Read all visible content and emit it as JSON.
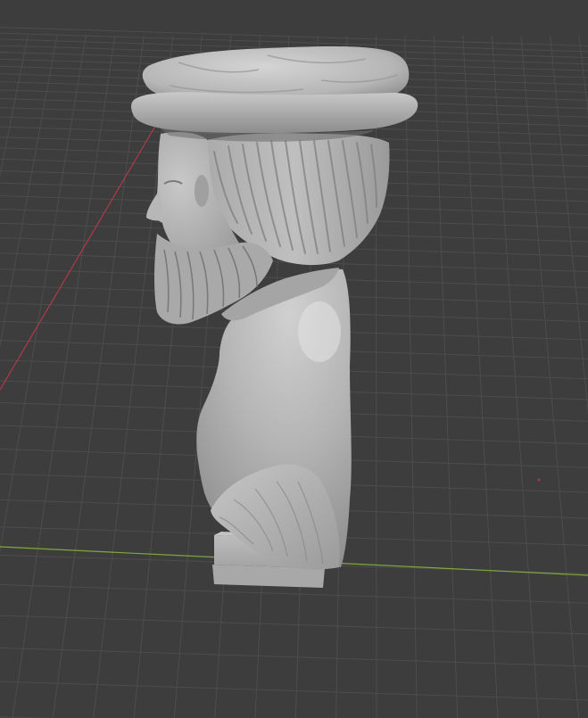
{
  "viewport": {
    "background_color": "#3d3d3d",
    "grid_line_color": "#4d4d4d",
    "x_axis_color": "#7fa83b",
    "y_axis_color": "#b03a49",
    "origin_marker_color": "#b0324a"
  },
  "model": {
    "description_icon": "bust-sculpture",
    "material_color": "#bdbdbd"
  }
}
